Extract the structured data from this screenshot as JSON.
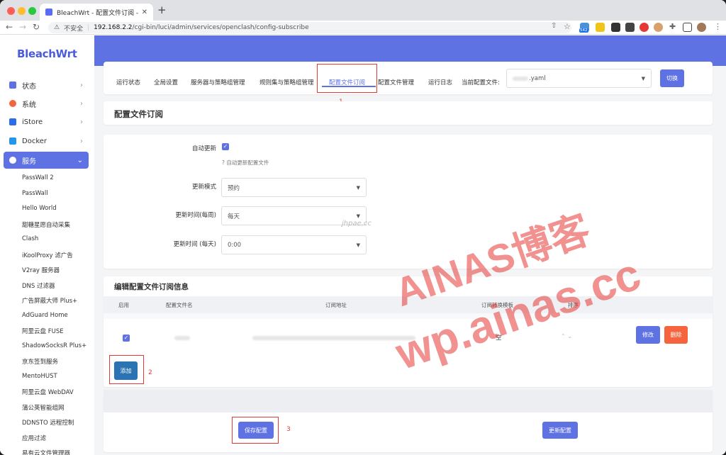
{
  "browser": {
    "tab_title": "BleachWrt - 配置文件订阅 - LuCI",
    "insecure_label": "不安全",
    "url_host": "192.168.2.2",
    "url_path": "/cgi-bin/luci/admin/services/openclash/config-subscribe",
    "ext_badge": "542"
  },
  "sidebar": {
    "logo": "BleachWrt",
    "menu": [
      {
        "label": "状态",
        "icon": "grid-icon"
      },
      {
        "label": "系统",
        "icon": "gear-icon"
      },
      {
        "label": "iStore",
        "icon": "cube-icon"
      },
      {
        "label": "Docker",
        "icon": "docker-icon"
      },
      {
        "label": "服务",
        "icon": "link-icon"
      }
    ],
    "services": [
      "PassWall 2",
      "PassWall",
      "Hello World",
      "甜糖星愿自动采集",
      "Clash",
      "iKoolProxy 滤广告",
      "V2ray 服务器",
      "DNS 过滤器",
      "广告屏蔽大师 Plus+",
      "AdGuard Home",
      "阿里云盘 FUSE",
      "ShadowSocksR Plus+",
      "京东签到服务",
      "MentoHUST",
      "阿里云盘 WebDAV",
      "蒲公英智能组网",
      "DDNSTO 远程控制",
      "应用过滤",
      "易有云文件管理器"
    ]
  },
  "topnav": {
    "tabs": [
      "运行状态",
      "全局设置",
      "服务器与策略组管理",
      "规则集与策略组管理",
      "配置文件订阅",
      "配置文件管理",
      "运行日志"
    ],
    "current_config_label": "当前配置文件:",
    "current_config_value": ".yaml",
    "switch_button": "切换"
  },
  "page_title": "配置文件订阅",
  "form": {
    "auto_update_label": "自动更新",
    "auto_update_hint": "自动更新配置文件",
    "update_mode_label": "更新模式",
    "update_mode_value": "预约",
    "update_week_label": "更新时间(每周)",
    "update_week_value": "每天",
    "update_day_label": "更新时间 (每天)",
    "update_day_value": "0:00"
  },
  "subscribe": {
    "title": "编辑配置文件订阅信息",
    "columns": [
      "启用",
      "配置文件名",
      "订阅地址",
      "订阅转换模板",
      "排序"
    ],
    "row_empty": "空",
    "edit_button": "修改",
    "delete_button": "删除",
    "add_button": "添加"
  },
  "footer": {
    "save_button": "保存配置",
    "update_button": "更新配置"
  },
  "annotations": [
    "1",
    "2",
    "3"
  ],
  "watermark": {
    "line1": "AINAS博客",
    "line2": "wp.ainas.cc",
    "small": "jhpae.cc"
  },
  "colors": {
    "accent": "#5e72e4",
    "danger": "#f5643c",
    "annotation": "#e53935"
  }
}
